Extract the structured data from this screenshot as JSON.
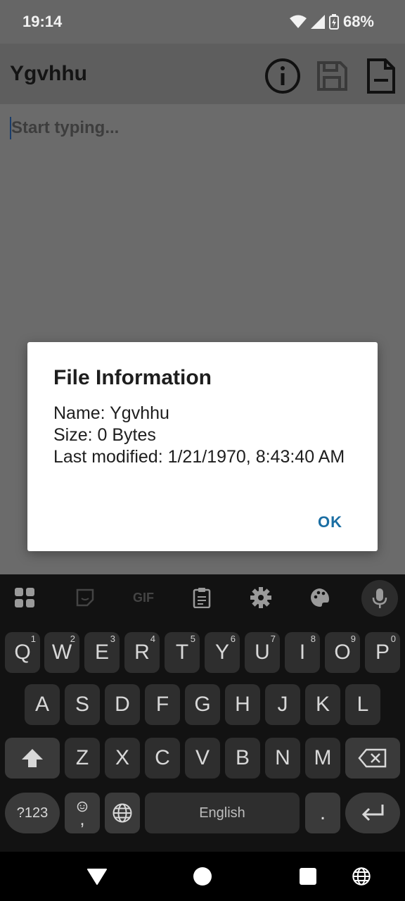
{
  "status": {
    "time": "19:14",
    "battery": "68%"
  },
  "app": {
    "title": "Ygvhhu"
  },
  "editor": {
    "placeholder": "Start typing..."
  },
  "dialog": {
    "title": "File Information",
    "name_line": "Name: Ygvhhu",
    "size_line": "Size: 0 Bytes",
    "modified_line": "Last modified: 1/21/1970, 8:43:40 AM",
    "ok": "OK"
  },
  "keyboard": {
    "tools": {
      "gif": "GIF"
    },
    "row1": [
      {
        "k": "Q",
        "h": "1"
      },
      {
        "k": "W",
        "h": "2"
      },
      {
        "k": "E",
        "h": "3"
      },
      {
        "k": "R",
        "h": "4"
      },
      {
        "k": "T",
        "h": "5"
      },
      {
        "k": "Y",
        "h": "6"
      },
      {
        "k": "U",
        "h": "7"
      },
      {
        "k": "I",
        "h": "8"
      },
      {
        "k": "O",
        "h": "9"
      },
      {
        "k": "P",
        "h": "0"
      }
    ],
    "row2": [
      "A",
      "S",
      "D",
      "F",
      "G",
      "H",
      "J",
      "K",
      "L"
    ],
    "row3": [
      "Z",
      "X",
      "C",
      "V",
      "B",
      "N",
      "M"
    ],
    "symbols": "?123",
    "comma": ",",
    "space": "English",
    "period": "."
  }
}
